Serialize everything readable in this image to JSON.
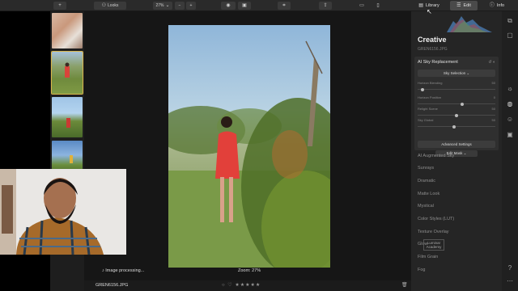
{
  "toolbar": {
    "add_icon": "plus-icon",
    "looks_label": "Looks",
    "zoom_value": "27%",
    "zoom_minus": "−",
    "zoom_plus": "+",
    "library_label": "Library",
    "edit_label": "Edit",
    "info_label": "Info"
  },
  "canvas": {
    "status_text": "Image processing...",
    "zoom_label": "Zoom: 27%",
    "filename": "GREN6156.JPG",
    "rating_stars": "★★★★★"
  },
  "panel": {
    "title": "Creative",
    "filename": "GREN6156.JPG",
    "tool_name": "AI Sky Replacement",
    "sky_selection": "Sky Selection",
    "sliders": [
      {
        "label": "Horizon Blending",
        "value": "50",
        "level": 0.05
      },
      {
        "label": "Horizon Position",
        "value": "0",
        "level": 0.55
      },
      {
        "label": "Relight Scene",
        "value": "50",
        "level": 0.5
      },
      {
        "label": "Sky Global",
        "value": "50",
        "level": 0.45
      }
    ],
    "advanced_settings": "Advanced Settings",
    "edit_mask": "Edit Mask",
    "tools": [
      "AI Augmented Sky",
      "Sunrays",
      "Dramatic",
      "Matte Look",
      "Mystical",
      "Color Styles (LUT)",
      "Texture Overlay",
      "Glow",
      "Film Grain",
      "Fog"
    ]
  },
  "watermark": {
    "line1": "Luminar",
    "line2": "Academy"
  },
  "colors": {
    "accent": "#d9b54a",
    "panel_bg": "#252525"
  }
}
